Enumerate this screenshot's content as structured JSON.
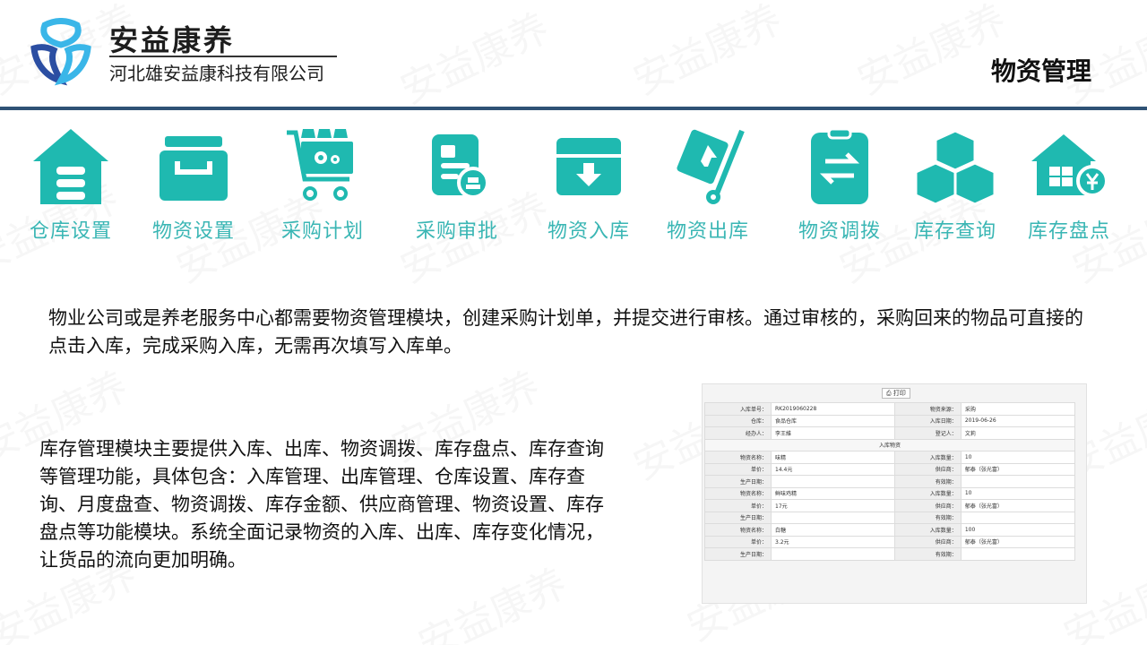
{
  "header": {
    "brand_name": "安益康养",
    "company": "河北雄安益康科技有限公司",
    "page_title": "物资管理",
    "watermark": "安益康养"
  },
  "modules": [
    {
      "label": "仓库设置",
      "icon": "warehouse-icon"
    },
    {
      "label": "物资设置",
      "icon": "drawer-box-icon"
    },
    {
      "label": "采购计划",
      "icon": "shopping-cart-icon"
    },
    {
      "label": "采购审批",
      "icon": "document-stamp-icon"
    },
    {
      "label": "物资入库",
      "icon": "box-in-icon"
    },
    {
      "label": "物资出库",
      "icon": "hand-truck-icon"
    },
    {
      "label": "物资调拨",
      "icon": "transfer-clipboard-icon"
    },
    {
      "label": "库存查询",
      "icon": "cubes-icon"
    },
    {
      "label": "库存盘点",
      "icon": "store-yuan-icon"
    }
  ],
  "text": {
    "para1": "物业公司或是养老服务中心都需要物资管理模块，创建采购计划单，并提交进行审核。通过审核的，采购回来的物品可直接的点击入库，完成采购入库，无需再次填写入库单。",
    "para2": "库存管理模块主要提供入库、出库、物资调拨、库存盘点、库存查询等管理功能，具体包含：入库管理、出库管理、仓库设置、库存查询、月度盘查、物资调拨、库存金额、供应商管理、物资设置、库存盘点等功能模块。系统全面记录物资的入库、出库、库存变化情况，让货品的流向更加明确。"
  },
  "form": {
    "print_label": "打印",
    "header_rows": [
      [
        "入库单号：",
        "RK2019060228",
        "物资来源：",
        "采购"
      ],
      [
        "仓库：",
        "食品仓库",
        "入库日期：",
        "2019-06-26"
      ],
      [
        "经办人：",
        "李王維",
        "登记人：",
        "文莉"
      ]
    ],
    "section_title": "入库物资",
    "items": [
      {
        "name_k": "物资名称：",
        "name": "味精",
        "qty_k": "入库数量：",
        "qty": "10",
        "price_k": "单价：",
        "price": "14.4元",
        "supplier_k": "供应商：",
        "supplier": "郁泰（张光富）",
        "prod_k": "生产日期：",
        "prod": "",
        "exp_k": "有效期：",
        "exp": ""
      },
      {
        "name_k": "物资名称：",
        "name": "鲜味鸡精",
        "qty_k": "入库数量：",
        "qty": "10",
        "price_k": "单价：",
        "price": "17元",
        "supplier_k": "供应商：",
        "supplier": "郁泰（张光富）",
        "prod_k": "生产日期：",
        "prod": "",
        "exp_k": "有效期：",
        "exp": ""
      },
      {
        "name_k": "物资名称：",
        "name": "白糖",
        "qty_k": "入库数量：",
        "qty": "100",
        "price_k": "单价：",
        "price": "3.2元",
        "supplier_k": "供应商：",
        "supplier": "郁泰（张光富）",
        "prod_k": "生产日期：",
        "prod": "",
        "exp_k": "有效期：",
        "exp": ""
      }
    ]
  },
  "colors": {
    "accent": "#3ab6b4",
    "icon": "#1fb9b0",
    "rule": "#2f5275"
  }
}
